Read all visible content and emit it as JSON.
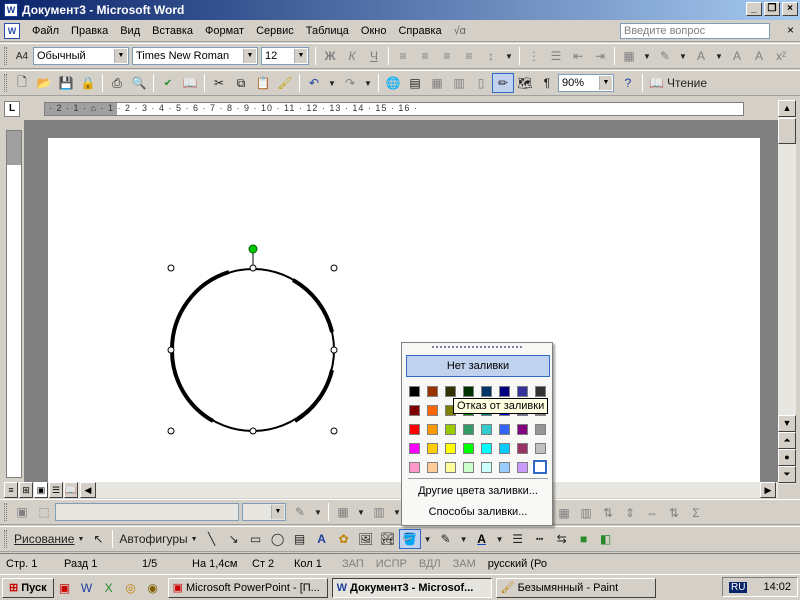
{
  "window": {
    "title": "Документ3 - Microsoft Word",
    "app_icon": "W",
    "controls": [
      "minimize-icon",
      "maximize-icon",
      "close-icon"
    ]
  },
  "menu": {
    "items": [
      "Файл",
      "Правка",
      "Вид",
      "Вставка",
      "Формат",
      "Сервис",
      "Таблица",
      "Окно",
      "Справка"
    ],
    "help_placeholder": "Введите вопрос",
    "close_glyph": "×"
  },
  "formatting_toolbar": {
    "style": "Обычный",
    "font": "Times New Roman",
    "size": "12",
    "bold": "Ж",
    "italic": "К",
    "underline": "Ч",
    "style_icon": "A4"
  },
  "standard_toolbar": {
    "zoom": "90%",
    "read_label": "Чтение",
    "pilcrow": "¶"
  },
  "ruler": {
    "corner": "L",
    "marks": "· 2 · 1 · ⌂ · 1 · 2 · 3 · 4 · 5 · 6 · 7 · 8 · 9 · 10 · 11 · 12 · 13 · 14 · 15 · 16 ·"
  },
  "drawing_toolbar": {
    "drawing_label": "Рисование",
    "autoshapes_label": "Автофигуры",
    "sigma": "Σ"
  },
  "fill_popup": {
    "no_fill": "Нет заливки",
    "more_colors": "Другие цвета заливки...",
    "fill_effects": "Способы заливки...",
    "colors": [
      [
        "#000000",
        "#993300",
        "#333300",
        "#003300",
        "#003366",
        "#000080",
        "#333399",
        "#333333"
      ],
      [
        "#800000",
        "#FF6600",
        "#808000",
        "#008000",
        "#008080",
        "#0000FF",
        "#666699",
        "#808080"
      ],
      [
        "#FF0000",
        "#FF9900",
        "#99CC00",
        "#339966",
        "#33CCCC",
        "#3366FF",
        "#800080",
        "#969696"
      ],
      [
        "#FF00FF",
        "#FFCC00",
        "#FFFF00",
        "#00FF00",
        "#00FFFF",
        "#00CCFF",
        "#993366",
        "#C0C0C0"
      ],
      [
        "#FF99CC",
        "#FFCC99",
        "#FFFF99",
        "#CCFFCC",
        "#CCFFFF",
        "#99CCFF",
        "#CC99FF",
        "#FFFFFF"
      ]
    ],
    "tooltip": "Отказ от заливки"
  },
  "status": {
    "page": "Стр. 1",
    "section": "Разд 1",
    "pages": "1/5",
    "at": "На 1,4см",
    "line": "Ст 2",
    "col": "Кол 1",
    "rec": "ЗАП",
    "trk": "ИСПР",
    "ext": "ВДЛ",
    "ovr": "ЗАМ",
    "lang": "русский (Ро"
  },
  "taskbar": {
    "start": "Пуск",
    "tasks": [
      {
        "label": "Microsoft PowerPoint - [П...",
        "active": false
      },
      {
        "label": "Документ3 - Microsof...",
        "active": true
      },
      {
        "label": "Безымянный - Paint",
        "active": false
      }
    ],
    "lang": "RU",
    "time": "14:02"
  }
}
